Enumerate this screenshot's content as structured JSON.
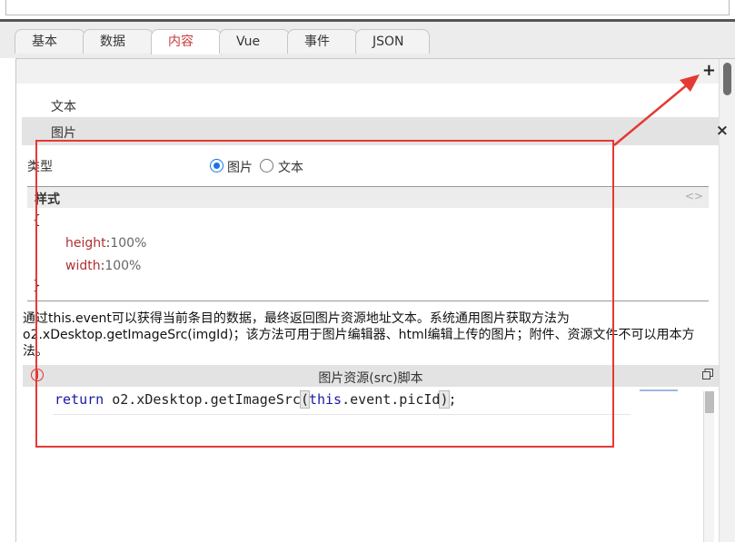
{
  "tabs": [
    {
      "label": "基本"
    },
    {
      "label": "数据"
    },
    {
      "label": "内容"
    },
    {
      "label": "Vue"
    },
    {
      "label": "事件"
    },
    {
      "label": "JSON"
    }
  ],
  "active_tab": "内容",
  "content": {
    "add_symbol": "+",
    "text_item": "文本",
    "image_item": "图片",
    "close_symbol": "×",
    "type_label": "类型",
    "type_options": [
      "图片",
      "文本"
    ],
    "type_selected": "图片",
    "style": {
      "title": "样式",
      "toggle_symbol": "<>",
      "open_brace": "{",
      "close_brace": "}",
      "props": [
        {
          "key": "height",
          "sep": ":",
          "value": "100%"
        },
        {
          "key": "width",
          "sep": ":",
          "value": "100%"
        }
      ]
    },
    "description": "通过this.event可以获得当前条目的数据，最终返回图片资源地址文本。系统通用图片获取方法为o2.xDesktop.getImageSrc(imgId)；该方法可用于图片编辑器、html编辑上传的图片；附件、资源文件不可以用本方法。",
    "script": {
      "title": "图片资源(src)脚本",
      "code_keyword": "return",
      "code_pre": " o2.xDesktop.getImageSrc",
      "code_open": "(",
      "code_this": "this",
      "code_post": ".event.picId",
      "code_close": ")",
      "code_end": ";"
    }
  },
  "colors": {
    "active_tab": "#c53b3b",
    "annotation_red": "#e53935",
    "radio_blue": "#1a73e8",
    "keyword_blue": "#1a1aa6",
    "css_key": "#b03030"
  }
}
